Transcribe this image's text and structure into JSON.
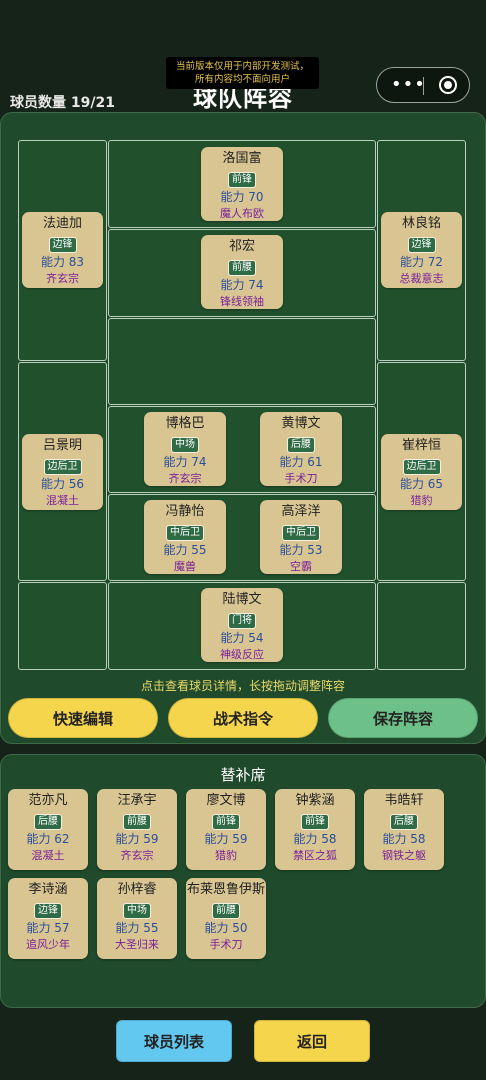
{
  "dev_notice": {
    "line1": "当前版本仅用于内部开发测试，",
    "line2": "所有内容均不面向用户"
  },
  "header": {
    "title": "球队阵容",
    "player_count": "球员数量 19/21"
  },
  "formation": [
    {
      "name": "洛国富",
      "position": "前锋",
      "ability": "能力 70",
      "skill": "魔人布欧"
    },
    {
      "name": "祁宏",
      "position": "前腰",
      "ability": "能力 74",
      "skill": "锋线领袖"
    },
    {
      "name": "法迪加",
      "position": "边锋",
      "ability": "能力 83",
      "skill": "齐玄宗"
    },
    {
      "name": "林良铭",
      "position": "边锋",
      "ability": "能力 72",
      "skill": "总裁意志"
    },
    {
      "name": "博格巴",
      "position": "中场",
      "ability": "能力 74",
      "skill": "齐玄宗"
    },
    {
      "name": "黄博文",
      "position": "后腰",
      "ability": "能力 61",
      "skill": "手术刀"
    },
    {
      "name": "吕景明",
      "position": "边后卫",
      "ability": "能力 56",
      "skill": "混凝土"
    },
    {
      "name": "崔梓恒",
      "position": "边后卫",
      "ability": "能力 65",
      "skill": "猎豹"
    },
    {
      "name": "冯静怡",
      "position": "中后卫",
      "ability": "能力 55",
      "skill": "魔兽"
    },
    {
      "name": "高泽洋",
      "position": "中后卫",
      "ability": "能力 53",
      "skill": "空霸"
    },
    {
      "name": "陆博文",
      "position": "门将",
      "ability": "能力 54",
      "skill": "神级反应"
    }
  ],
  "hint": "点击查看球员详情，长按拖动调整阵容",
  "actions": {
    "quick_edit": "快速编辑",
    "tactics": "战术指令",
    "save": "保存阵容"
  },
  "bench": {
    "title": "替补席",
    "players": [
      {
        "name": "范亦凡",
        "position": "后腰",
        "ability": "能力 62",
        "skill": "混凝土"
      },
      {
        "name": "汪承宇",
        "position": "前腰",
        "ability": "能力 59",
        "skill": "齐玄宗"
      },
      {
        "name": "廖文博",
        "position": "前锋",
        "ability": "能力 59",
        "skill": "猎豹"
      },
      {
        "name": "钟紫涵",
        "position": "前锋",
        "ability": "能力 58",
        "skill": "禁区之狐"
      },
      {
        "name": "韦皓轩",
        "position": "后腰",
        "ability": "能力 58",
        "skill": "钢铁之躯"
      },
      {
        "name": "李诗涵",
        "position": "边锋",
        "ability": "能力 57",
        "skill": "追风少年"
      },
      {
        "name": "孙梓睿",
        "position": "中场",
        "ability": "能力 55",
        "skill": "大圣归来"
      },
      {
        "name": "布莱恩鲁伊斯",
        "position": "前腰",
        "ability": "能力 50",
        "skill": "手术刀"
      }
    ]
  },
  "footer": {
    "player_list": "球员列表",
    "back": "返回"
  },
  "colors": {
    "quick_edit": "#f5d54b",
    "tactics": "#f5d54b",
    "save": "#6cc088",
    "player_list": "#62c8f0",
    "back": "#f5d54b"
  }
}
